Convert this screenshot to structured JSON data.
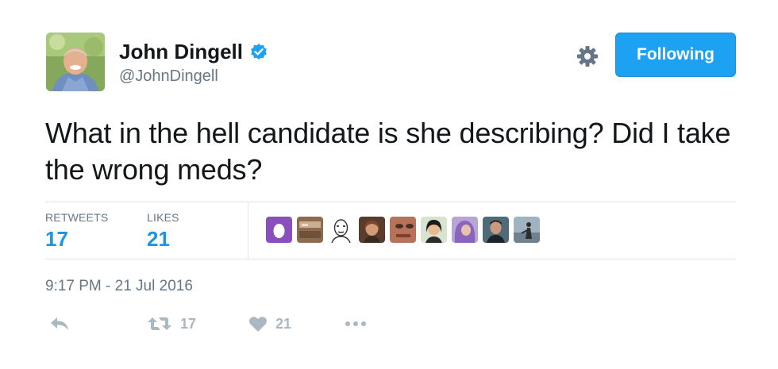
{
  "user": {
    "name": "John Dingell",
    "handle": "@JohnDingell",
    "verified": true
  },
  "follow_button": {
    "label": "Following"
  },
  "tweet": {
    "text": "What in the hell candidate is she describing? Did I take the wrong meds?"
  },
  "stats": {
    "retweets_label": "RETWEETS",
    "retweets_value": "17",
    "likes_label": "LIKES",
    "likes_value": "21"
  },
  "likers": [
    {
      "icon": "egg-avatar"
    },
    {
      "icon": "photo-avatar"
    },
    {
      "icon": "sketch-face-avatar"
    },
    {
      "icon": "woman-avatar"
    },
    {
      "icon": "closeup-face-avatar"
    },
    {
      "icon": "woman-smiling-avatar"
    },
    {
      "icon": "purple-hair-avatar"
    },
    {
      "icon": "man-avatar"
    },
    {
      "icon": "figure-avatar"
    }
  ],
  "timestamp": "9:17 PM - 21 Jul 2016",
  "actions": {
    "retweet_count": "17",
    "like_count": "21"
  },
  "colors": {
    "accent": "#1da1f2",
    "stat_value": "#1b95e0",
    "muted": "#657786",
    "icon_muted": "#aab8c2"
  }
}
